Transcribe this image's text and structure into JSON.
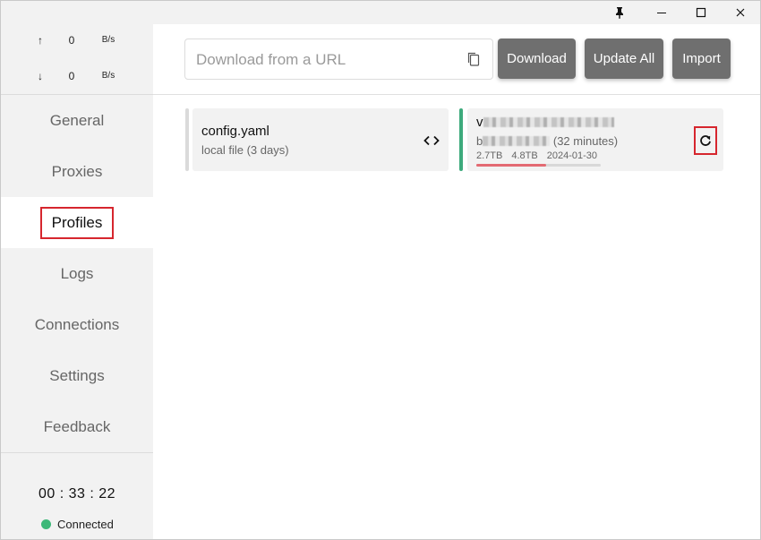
{
  "titlebar": {
    "pin_icon": "pin-icon",
    "minimize_icon": "minimize-icon",
    "maximize_icon": "maximize-icon",
    "close_icon": "close-icon"
  },
  "traffic": {
    "upload": {
      "arrow": "↑",
      "value": "0",
      "unit": "B/s"
    },
    "download": {
      "arrow": "↓",
      "value": "0",
      "unit": "B/s"
    }
  },
  "nav": {
    "items": [
      {
        "label": "General"
      },
      {
        "label": "Proxies"
      },
      {
        "label": "Profiles"
      },
      {
        "label": "Logs"
      },
      {
        "label": "Connections"
      },
      {
        "label": "Settings"
      },
      {
        "label": "Feedback"
      }
    ],
    "active": "Profiles"
  },
  "footer": {
    "uptime": "00 : 33 : 22",
    "status": "Connected",
    "status_color": "#3cb878"
  },
  "toolbar": {
    "url_placeholder": "Download from a URL",
    "download_label": "Download",
    "update_all_label": "Update All",
    "import_label": "Import"
  },
  "profiles": [
    {
      "name": "config.yaml",
      "subtitle": "local file (3 days)",
      "bar_color": "#dadada"
    },
    {
      "name_prefix": "v",
      "sub_prefix": "b",
      "updated": "(32 minutes)",
      "used": "2.7TB",
      "total": "4.8TB",
      "expires": "2024-01-30",
      "usage_fraction": 0.56,
      "bar_color": "#3daa7c"
    }
  ],
  "colors": {
    "accent_red": "#d6262e",
    "button_gray": "#6f6f6f",
    "usage_red": "#e36a72"
  }
}
